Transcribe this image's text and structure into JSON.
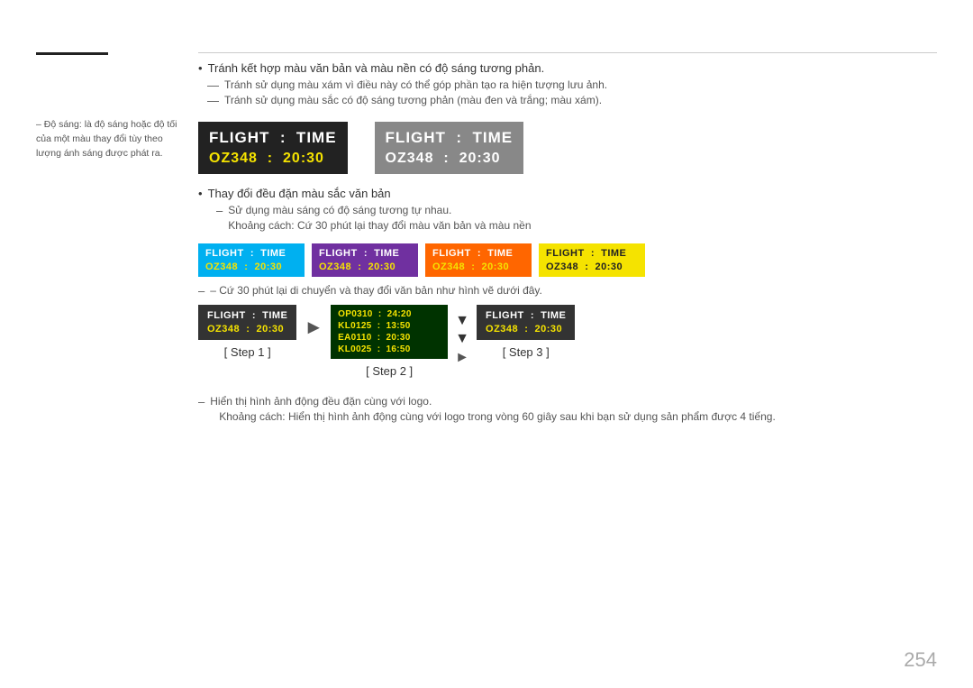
{
  "page_number": "254",
  "sidebar": {
    "note": "– Độ sáng: là độ sáng hoặc độ tối của một màu thay đổi tùy theo lượng ánh sáng được phát ra."
  },
  "bullets": {
    "b1": "Tránh kết hợp màu văn bản và màu nền có độ sáng tương phản.",
    "d1": "Tránh sử dụng màu xám vì điều này có thể góp phần tạo ra hiện tượng lưu ảnh.",
    "d2": "Tránh sử dụng màu sắc có độ sáng tương phản (màu đen và trắng; màu xám)."
  },
  "cards_large": {
    "card1": {
      "line1": "FLIGHT  :  TIME",
      "line2": "OZ348  :  20:30",
      "bg": "#222",
      "color1": "#ffffff",
      "color2": "#f5e300"
    },
    "card2": {
      "line1": "FLIGHT  :  TIME",
      "line2": "OZ348  :  20:30",
      "bg": "#888888",
      "color1": "#ffffff",
      "color2": "#ffffff"
    }
  },
  "sub_bullet": {
    "b1": "Thay đổi đều đặn màu sắc văn bản",
    "d1": "Sử dụng màu sáng có độ sáng tương tự nhau.",
    "d2": "Khoảng cách: Cứ 30 phút lại thay đổi màu văn bản và màu nền"
  },
  "small_cards": [
    {
      "id": "cyan",
      "line1": "FLIGHT  :  TIME",
      "line2": "OZ348  :  20:30",
      "bg": "#00b0f0",
      "c1": "#fff",
      "c2": "#f5e300"
    },
    {
      "id": "purple",
      "line1": "FLIGHT  :  TIME",
      "line2": "OZ348  :  20:30",
      "bg": "#7030a0",
      "c1": "#fff",
      "c2": "#f5e300"
    },
    {
      "id": "orange",
      "line1": "FLIGHT  :  TIME",
      "line2": "OZ348  :  20:30",
      "bg": "#ff6600",
      "c1": "#fff",
      "c2": "#f5e300"
    },
    {
      "id": "yellow",
      "line1": "FLIGHT  :  TIME",
      "line2": "OZ348  :  20:30",
      "bg": "#f5e300",
      "c1": "#222",
      "c2": "#222"
    }
  ],
  "rotate_note": "– Cứ 30 phút lại di chuyển và thay đổi văn bản như hình vẽ dưới đây.",
  "steps": {
    "step1": {
      "line1": "FLIGHT  :  TIME",
      "line2": "OZ348  :  20:30",
      "label": "[ Step 1 ]"
    },
    "step2": {
      "rows": [
        "OP0310  :  24:20",
        "KL0125  :  13:50",
        "EA0110  :  20:30",
        "KL0025  :  16:50"
      ],
      "label": "[ Step 2 ]"
    },
    "step3": {
      "line1": "FLIGHT  :  TIME",
      "line2": "OZ348  :  20:30",
      "label": "[ Step 3 ]"
    }
  },
  "bottom_notes": {
    "d1": "Hiển thị hình ảnh động đều đặn cùng với logo.",
    "d2": "Khoảng cách: Hiển thị hình ảnh động cùng với logo trong vòng 60 giây sau khi bạn sử dụng sản phẩm được 4 tiếng."
  }
}
